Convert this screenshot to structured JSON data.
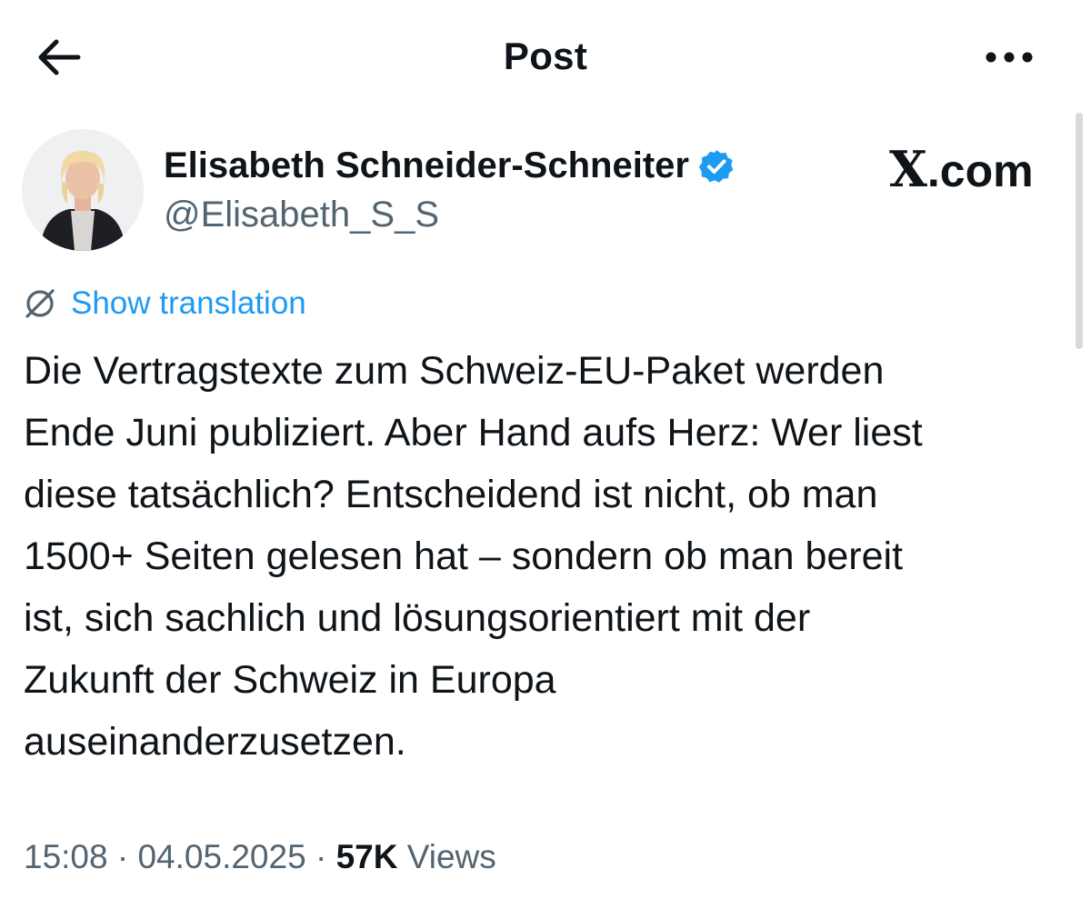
{
  "header": {
    "title": "Post",
    "back_icon": "arrow-left-icon",
    "more_icon": "more-horizontal-icon"
  },
  "author": {
    "name": "Elisabeth Schneider-Schneiter",
    "handle": "@Elisabeth_S_S",
    "verified": true,
    "verified_color": "#1d9bf0",
    "avatar_icon": "profile-photo"
  },
  "watermark": {
    "x": "X",
    "rest": ".com"
  },
  "translation": {
    "label": "Show translation",
    "icon": "globe-slash-icon"
  },
  "post": {
    "lines": [
      "Die Vertragstexte zum Schweiz-EU-Paket werden",
      "Ende Juni publiziert. Aber Hand aufs Herz: Wer liest",
      "diese tatsächlich? Entscheidend ist nicht, ob man",
      "1500+ Seiten gelesen hat – sondern ob man bereit",
      "ist, sich sachlich und lösungsorientiert mit der",
      "Zukunft der Schweiz in Europa",
      "auseinanderzusetzen."
    ]
  },
  "meta": {
    "time": "15:08",
    "separator": "·",
    "date": "04.05.2025",
    "views_count": "57K",
    "views_label": "Views"
  },
  "colors": {
    "accent": "#1d9bf0",
    "text": "#0f1419",
    "secondary": "#536471"
  }
}
